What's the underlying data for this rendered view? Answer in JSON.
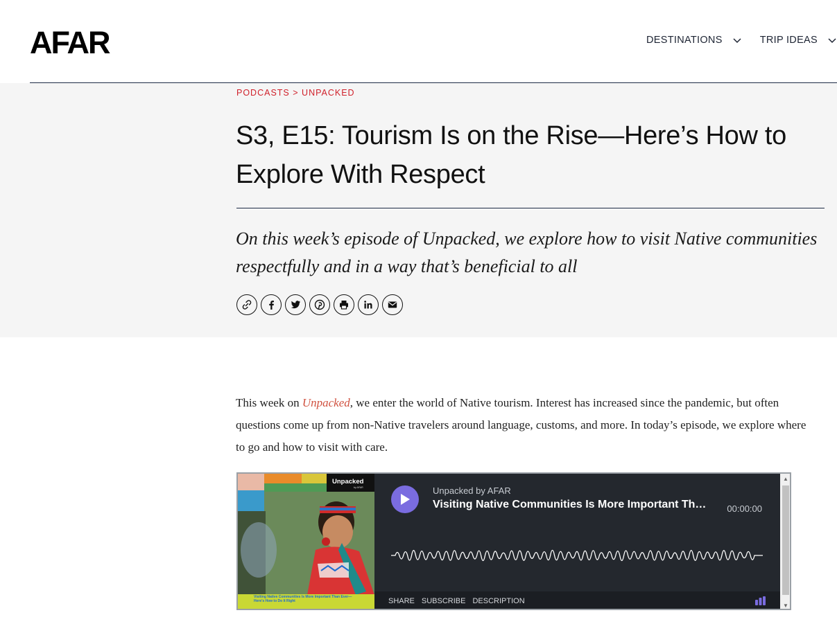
{
  "header": {
    "logo": "AFAR",
    "nav": [
      {
        "label": "DESTINATIONS"
      },
      {
        "label": "TRIP IDEAS"
      }
    ]
  },
  "breadcrumb": {
    "section": "PODCASTS",
    "separator": ">",
    "subsection": "UNPACKED"
  },
  "article": {
    "headline": "S3, E15: Tourism Is on the Rise—Here’s How to Explore With Respect",
    "dek": "On this week’s episode of Unpacked, we explore how to visit Native communities respectfully and in a way that’s beneficial to all",
    "body_prefix": "This week on ",
    "body_link": "Unpacked",
    "body_suffix": ", we enter the world of Native tourism. Interest has increased since the pandemic, but often questions come up from non-Native travelers around language, customs, and more. In today’s episode, we explore where to go and how to visit with care."
  },
  "share": {
    "icons": [
      "link-icon",
      "facebook-icon",
      "twitter-icon",
      "pinterest-icon",
      "print-icon",
      "linkedin-icon",
      "email-icon"
    ]
  },
  "player": {
    "cover_brand": "Unpacked",
    "cover_brand_sub": "by AFAR",
    "cover_caption": "Visiting Native Communities Is More Important Than Ever—Here’s How to Do It Right",
    "show_title": "Unpacked by AFAR",
    "episode_title": "Visiting Native Communities Is More Important Tha...",
    "time": "00:00:00",
    "footer": [
      "SHARE",
      "SUBSCRIBE",
      "DESCRIPTION"
    ],
    "accent_color": "#7a6ce0"
  },
  "colors": {
    "breadcrumb": "#d0202a",
    "link": "#d0513f",
    "hero_bg": "#f5f5f5",
    "rule": "#1d2a44"
  }
}
